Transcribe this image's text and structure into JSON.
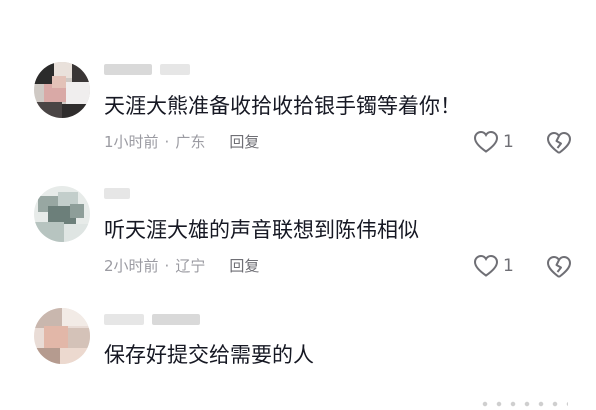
{
  "comments": [
    {
      "text": "天涯大熊准备收拾收拾银手镯等着你！",
      "time": "1小时前",
      "separator": "·",
      "location": "广东",
      "reply_label": "回复",
      "likes": "1",
      "like_icon": "heart-outline-icon",
      "dislike_icon": "broken-heart-icon"
    },
    {
      "text": "听天涯大雄的声音联想到陈伟相似",
      "time": "2小时前",
      "separator": "·",
      "location": "辽宁",
      "reply_label": "回复",
      "likes": "1",
      "like_icon": "heart-outline-icon",
      "dislike_icon": "broken-heart-icon"
    },
    {
      "text": "保存好提交给需要的人"
    }
  ],
  "colors": {
    "text": "#161823",
    "meta": "#9b9ba2",
    "icon": "#6f6f75"
  }
}
